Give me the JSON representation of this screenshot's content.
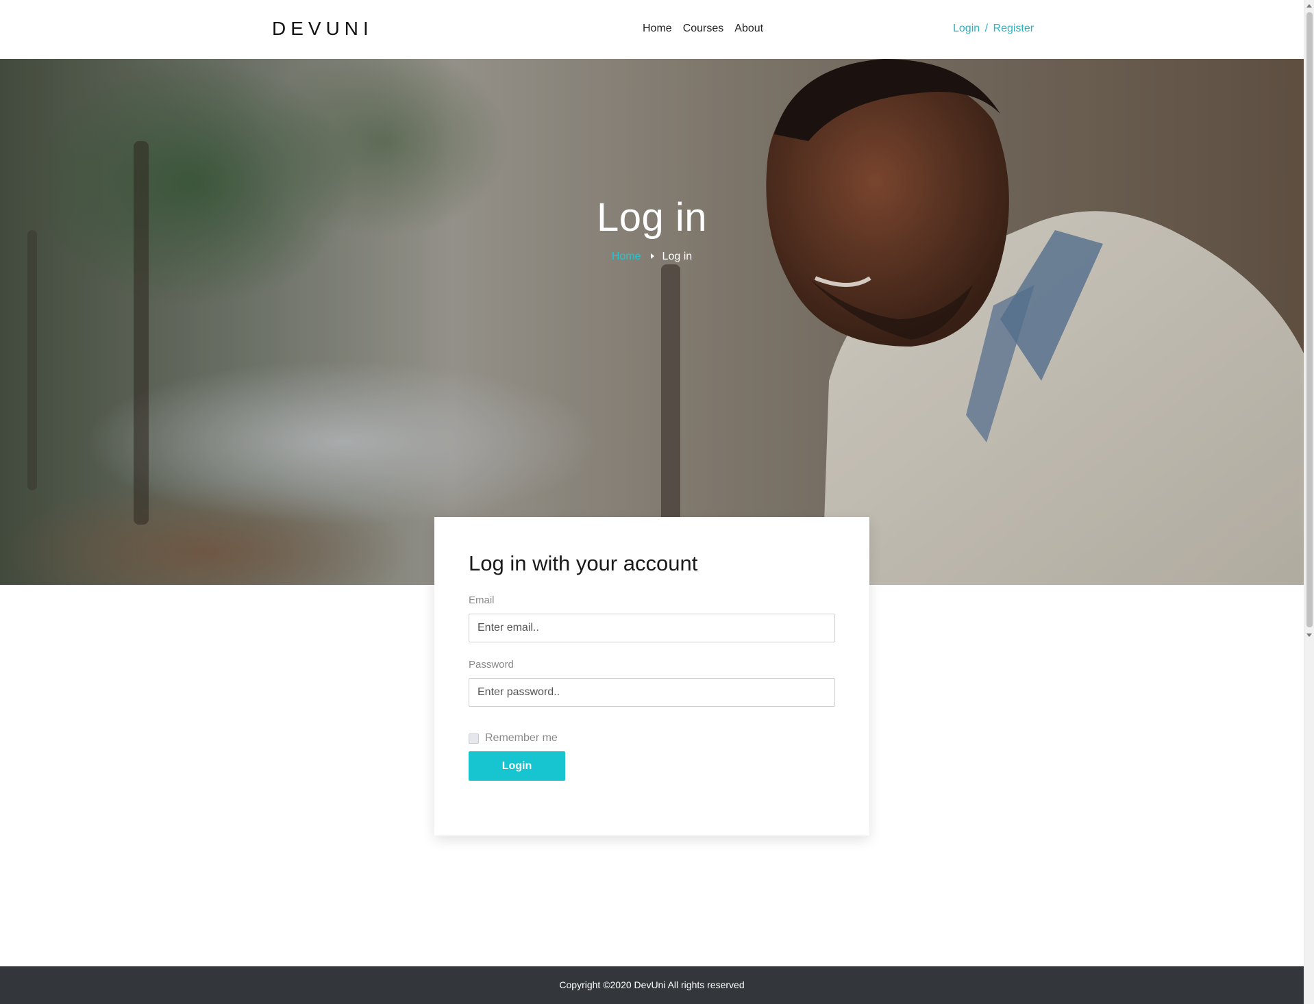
{
  "header": {
    "brand": "DEVUNI",
    "nav": [
      "Home",
      "Courses",
      "About"
    ],
    "login_label": "Login",
    "separator": "/",
    "register_label": "Register"
  },
  "hero": {
    "title": "Log in",
    "breadcrumb": {
      "home": "Home",
      "current": "Log in"
    }
  },
  "form": {
    "heading": "Log in with your account",
    "email_label": "Email",
    "email_placeholder": "Enter email..",
    "email_value": "",
    "password_label": "Password",
    "password_placeholder": "Enter password..",
    "password_value": "",
    "remember_label": "Remember me",
    "remember_checked": false,
    "submit_label": "Login"
  },
  "footer": {
    "copyright": "Copyright ©2020 DevUni All rights reserved"
  },
  "colors": {
    "accent": "#17c5d0",
    "link": "#2bb3c0",
    "footer_bg": "#33363b"
  }
}
